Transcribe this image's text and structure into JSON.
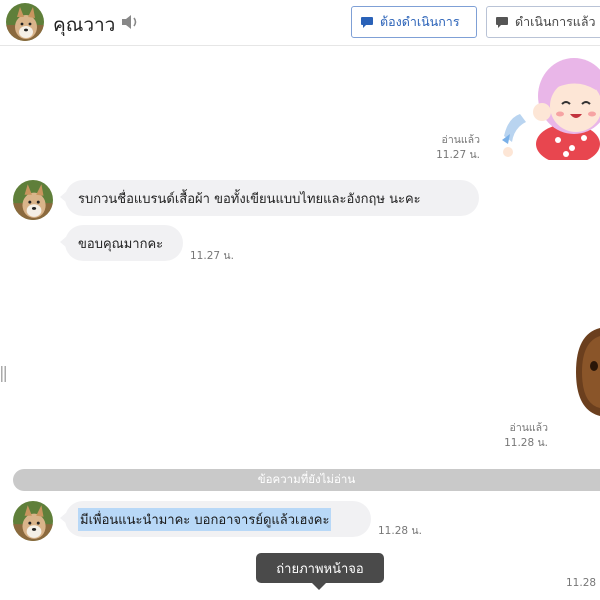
{
  "header": {
    "contact_name": "คุณวาว",
    "icon": "speaker-icon",
    "action_todo_label": "ต้องดำเนินการ",
    "action_done_label": "ดำเนินการแล้ว"
  },
  "messages": [
    {
      "kind": "sticker",
      "from": "me",
      "sticker": "pink-hair-girl-sticker",
      "read_label": "อ่านแล้ว",
      "time": "11.27 น."
    },
    {
      "kind": "text",
      "from": "contact",
      "text": "รบกวนชื่อแบรนด์เสื้อผ้า ขอทั้งเขียนแบบไทยและอังกฤษ นะคะ"
    },
    {
      "kind": "text",
      "from": "contact",
      "text": "ขอบคุณมากคะ",
      "time": "11.27 น."
    },
    {
      "kind": "sticker",
      "from": "me",
      "sticker": "brown-bear-sticker",
      "read_label": "อ่านแล้ว",
      "time": "11.28 น."
    },
    {
      "kind": "divider",
      "text": "ข้อความที่ยังไม่อ่าน"
    },
    {
      "kind": "text",
      "from": "contact",
      "text": "มีเพื่อนแนะนำมาคะ บอกอาจารย์ดูแล้วเฮงคะ",
      "time": "11.28 น.",
      "highlighted": true
    }
  ],
  "footer_partial_time": "11.28",
  "tooltip": {
    "text": "ถ่ายภาพหน้าจอ"
  },
  "colors": {
    "bubble": "#f1f1f3",
    "highlight": "#b8d8f7",
    "divider": "#c9c9c9",
    "tooltip": "#4a4a4a",
    "accent": "#2a62b8"
  }
}
